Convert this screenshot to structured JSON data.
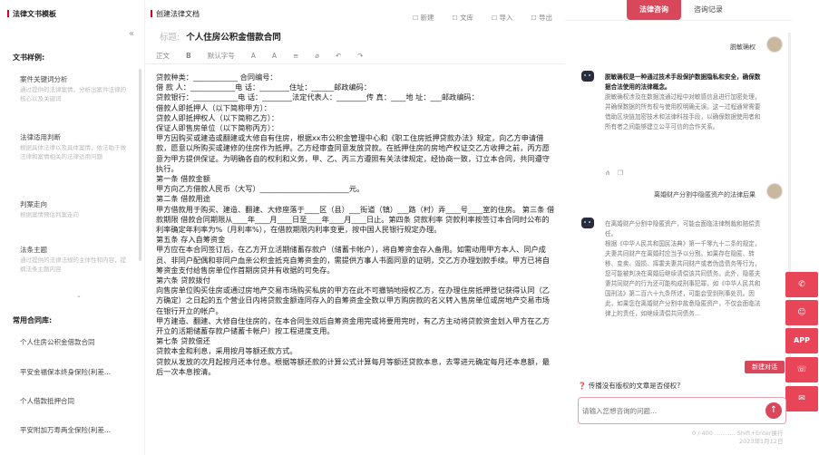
{
  "left": {
    "title": "法律文书模板",
    "examples_label": "文书样例:",
    "templates": [
      {
        "title": "案件关键词分析",
        "desc": "通过提供的法律案情，分析出案件法律的核心以及关键词"
      },
      {
        "title": "法律适用判断",
        "desc": "根据具体法律以及具体案情，依法助于做法律和案情相关的法律适用问题"
      },
      {
        "title": "判案走向",
        "desc": "根据案情预估判案走向"
      },
      {
        "title": "法条主题",
        "desc": "通过提供的法律法规的主体性和内容，提纲法条主题内容"
      }
    ],
    "more": "⌄",
    "common_label": "常用合同库:",
    "common": [
      "个人住房公积金借款合同",
      "平安金福保本终身保险(利差...",
      "个人借款抵押合同",
      "平安附加万寿两全保险(利差..."
    ]
  },
  "middle": {
    "title": "创建法律文档",
    "actions": [
      "新建",
      "文库",
      "导入",
      "导出"
    ],
    "doc_title_label": "标题:",
    "doc_title": "个人住房公积金借款合同",
    "toolbar": [
      "正文",
      "B",
      "默认字号",
      "A",
      "A",
      "≡",
      "⌀",
      "↶",
      "↷"
    ],
    "lines": [
      "贷款种类：____________  合同编号：",
      "借 款 人：____________电 话：________住址：______邮政编码：",
      "贷款银行：____________电 话：________法定代表人：________传 真：____地 址：___邮政编码：",
      "借款人即抵押人（以下简称甲方）：",
      "贷款人即抵押权人（以下简称乙方）：",
      "保证人即售房单位（以下简称丙方）：",
      "甲方因购买或建造或翻建或大修自有住房，根据xx市公积金管理中心和《职工住房抵押贷款办法》规定，向乙方申请借款，愿意以所购买或建修的住房作为抵押。乙方经审查同意发放贷款。在抵押住房的房地产权证交乙方收押之前，丙方愿意为甲方提供保证。为明确各自的权利和义务，甲、乙、丙三方遵照有关法律规定，经协商一致，订立本合同，共同遵守执行。",
      "第一条 借款金额",
      "甲方向乙方借款人民币（大写）________________________元。",
      "第二条 借款用途",
      "甲方借款用于购买、建造、翻建、大修座落于____区（县）___街道（镇）___路（村）弄____号____室的住房。 第三条 借款期限 借款合同期限从____年____月____日至____年____月____日止。第四条 贷款利率 贷款利率按签订本合同时公布的利率确定年利率为%（月利率%），在借款期限内利率变更，按中国人民银行规定办理。",
      "第五条 存入自筹资金",
      "甲方应在本合同签订后，在乙方开立活期储蓄存款户（储蓄卡帐户），将自筹资金存入备用。如需动用甲方本人、同户成员、非同户配偶和非同户血亲公积金抵充自筹资金的，需提供方事人书面同意的证明，交乙方办理划款手续。甲方已将自筹资金支付给售房单位作首期房贷并有收据的可免存。",
      "第六条 贷款拨付",
      "向售房单位购买住房或通过房地产交易市场购买私房的甲方在此不可撤销地授权乙方，在办理住房抵押登记获得认同（乙方确定）之日起的五个营业日内将贷款金额连同存入的自筹资金全数以甲方购房款的名义转入售房单位或房地产交易市场在银行开立的帐户。",
      "甲方建造、翻建、大修自住住房的，在本合同生效后自筹资金用完或将要用完时，有乙方主动将贷款资金划入甲方在乙方开立的活期储蓄存款户储蓄卡帐户）按工程进度支用。",
      "第七条 贷款偿还",
      "贷款本金和利息，采用按月等额还款方式。",
      "贷款从发放的次月起按月还本付息。根据等额还款的计算公式计算每月等额还贷款本息，去零进元确定每月还本息额，最后一次本息按清。"
    ]
  },
  "right": {
    "tabs": [
      "法律咨询",
      "咨询记录"
    ],
    "q1": "脱敏确权",
    "a1_title": "脱敏确权是一种通过技术手段保护数据隐私和安全，确保数据合法使用的法律概念。",
    "a1": "脱敏确权涉及在数据流通过程中对敏感信息进行加密处理，并确保数据的所有权与使用权明确无误。这一过程通常需要借助区块链加密技术和法律科技手段，以确保数据使用者和所有者之间能够建立公平可信的合作关系。",
    "q2": "离婚财产分割中隐匿资产的法律后果",
    "a2_title": "在离婚财产分割中隐匿资产，可能会面临法律制裁和赔偿责任。",
    "a2": "根据《中华人民共和国民法典》第一千零九十二条的规定，夫妻共同财产在离婚时应当予以分割。如果存在隐匿、转移、变卖、毁损、挥霍夫妻共同财产或者伪造债务等行为，您可能被判决在离婚后继续清偿该共同债务。此外，隐匿夫妻共同财产的行为还可能构成刑事犯罪，如《中华人民共和国刑法》第二百六十九条所述，可能会受到刑事处罚。因此，如果您在离婚财产分割中故意隐匿资产，不仅会面临法律上的责任，如继续清偿共同债务...",
    "float_buttons": [
      "✆",
      "☺",
      "APP",
      "☏",
      "✉"
    ],
    "new_chat": "新建对话",
    "tip": "传播没有版权的文章是否侵权?",
    "input_placeholder": "请输入您想咨询的问题...",
    "send": "↑",
    "footer_line1": "0 / 400 ...........  Shift+Enter换行",
    "footer_line2": "2023年1月12日"
  }
}
